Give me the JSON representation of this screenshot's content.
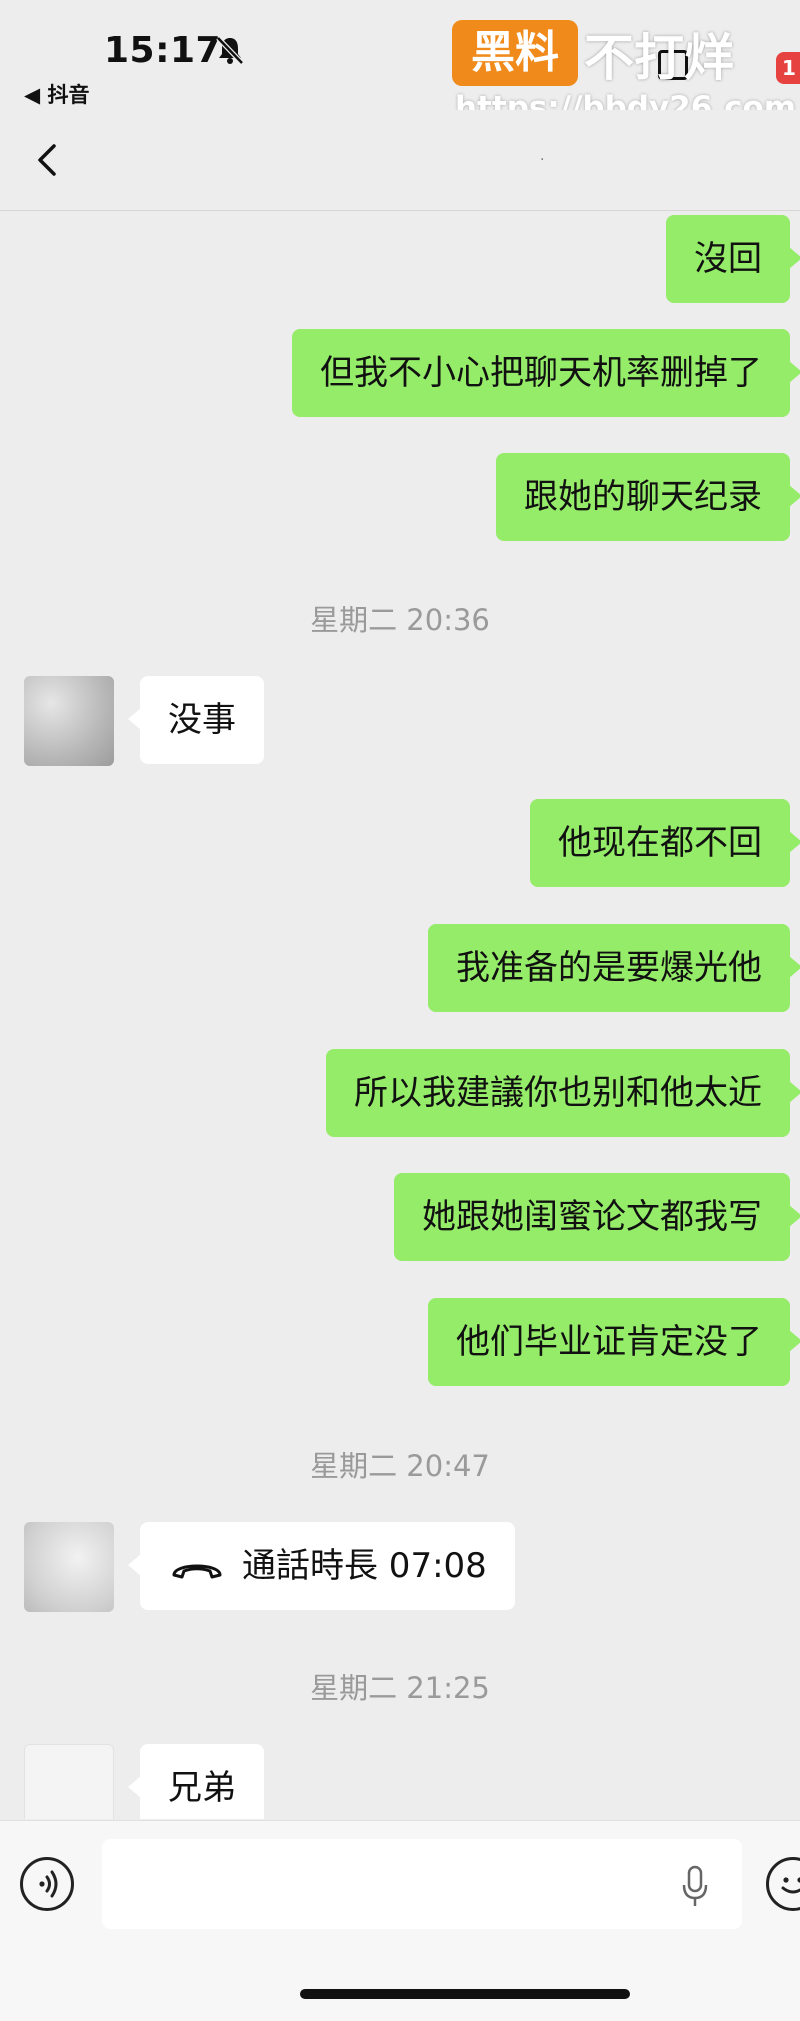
{
  "status_bar": {
    "time": "15:17",
    "back_app_label": "◀ 抖音",
    "badge": "1"
  },
  "watermark": {
    "logo": "黑料",
    "text": "不打烊",
    "url": "https://bbdy26.com"
  },
  "nav": {
    "title": "·"
  },
  "messages": [
    {
      "side": "right",
      "text": "沒回"
    },
    {
      "side": "right",
      "text": "但我不小心把聊天机率删掉了"
    },
    {
      "side": "right",
      "text": "跟她的聊天纪录"
    },
    {
      "side": "time",
      "text": "星期二 20:36"
    },
    {
      "side": "left",
      "text": "没事"
    },
    {
      "side": "right",
      "text": "他现在都不回"
    },
    {
      "side": "right",
      "text": "我准备的是要爆光他"
    },
    {
      "side": "right",
      "text": "所以我建議你也别和他太近"
    },
    {
      "side": "right",
      "text": "她跟她闺蜜论文都我写"
    },
    {
      "side": "right",
      "text": "他们毕业证肯定没了"
    },
    {
      "side": "time",
      "text": "星期二 20:47"
    },
    {
      "side": "left",
      "text": "通話時長 07:08"
    },
    {
      "side": "time",
      "text": "星期二 21:25"
    },
    {
      "side": "left",
      "text": "兄弟"
    }
  ],
  "input": {
    "value": "",
    "placeholder": ""
  },
  "colors": {
    "sent_bubble": "#95ec69",
    "received_bubble": "#ffffff",
    "background": "#ededed",
    "watermark_orange": "#f08a1b"
  }
}
